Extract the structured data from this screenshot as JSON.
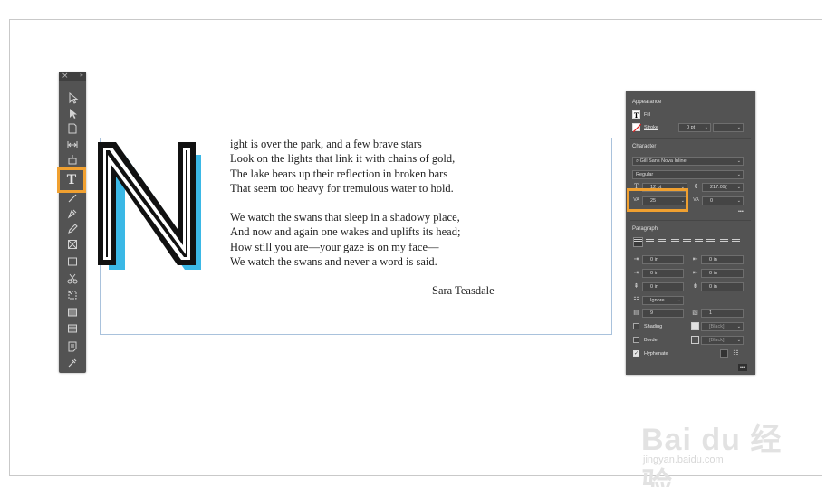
{
  "document": {
    "drop_cap": "N",
    "stanza1": [
      "ight is over the park, and a few brave stars",
      "Look on the lights that link it with chains of gold,",
      "The lake bears up their reflection in broken bars",
      "That seem too heavy for tremulous water to hold."
    ],
    "stanza2": [
      "We watch the swans that sleep in a shadowy place,",
      "And now and again one wakes and uplifts its head;",
      "How still you are—your gaze is on my face—",
      "We watch the swans and never a word is said."
    ],
    "author": "Sara Teasdale"
  },
  "tools_panel": {
    "close_glyph": "×",
    "collapse_glyph": "»",
    "type_tool_glyph": "T"
  },
  "properties": {
    "appearance": {
      "title": "Appearance",
      "fill_label": "Fill",
      "stroke_label": "Stroke",
      "stroke_weight": "0 pt"
    },
    "character": {
      "title": "Character",
      "font_family": "Gill Sans Nova Inline",
      "font_style": "Regular",
      "font_size": "12 pt",
      "leading": "217.09(",
      "kerning": "25",
      "tracking": "0"
    },
    "paragraph": {
      "title": "Paragraph",
      "left_indent": "0 in",
      "right_indent": "0 in",
      "first_line_indent": "0 in",
      "last_line_indent": "0 in",
      "space_before": "0 in",
      "space_after": "0 in",
      "align_grid": "Ignore",
      "drop_cap_lines": "9",
      "drop_cap_chars": "1",
      "shading_label": "Shading",
      "shading_swatch": "[Black]",
      "border_label": "Border",
      "border_swatch": "[Black]",
      "hyphenate_label": "Hyphenate",
      "more_glyph": "•••"
    }
  },
  "watermark": {
    "logo": "Bai du 经验",
    "url": "jingyan.baidu.com"
  },
  "colors": {
    "highlight": "#f0a030",
    "panel_bg": "#535353",
    "dropcap_cyan": "#3bb8e6",
    "frame_border": "#a9c2dc"
  }
}
